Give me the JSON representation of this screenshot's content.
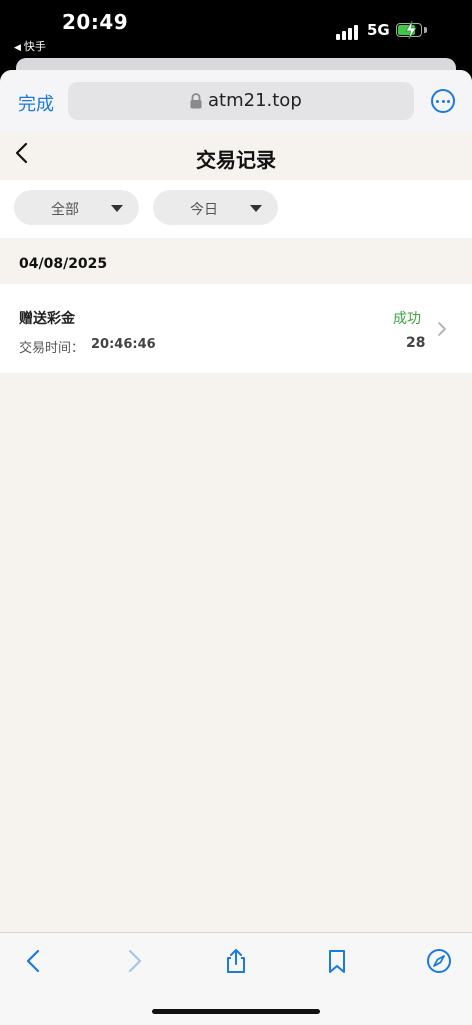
{
  "status_bar": {
    "time": "20:49",
    "back_app": "快手",
    "network": "5G"
  },
  "browser": {
    "done_label": "完成",
    "url": "atm21.top"
  },
  "page": {
    "title": "交易记录"
  },
  "filters": [
    {
      "label": "全部"
    },
    {
      "label": "今日"
    }
  ],
  "date_group": "04/08/2025",
  "record": {
    "title": "赠送彩金",
    "time_label": "交易时间：",
    "time_value": "20:46:46",
    "status": "成功",
    "amount": "28"
  },
  "toolbar": {
    "icons": [
      "back-icon",
      "forward-icon",
      "share-icon",
      "bookmarks-icon",
      "compass-icon"
    ]
  },
  "colors": {
    "accent": "#1a7ae0",
    "success": "#3aa640",
    "page_bg": "#f6f3ee"
  }
}
